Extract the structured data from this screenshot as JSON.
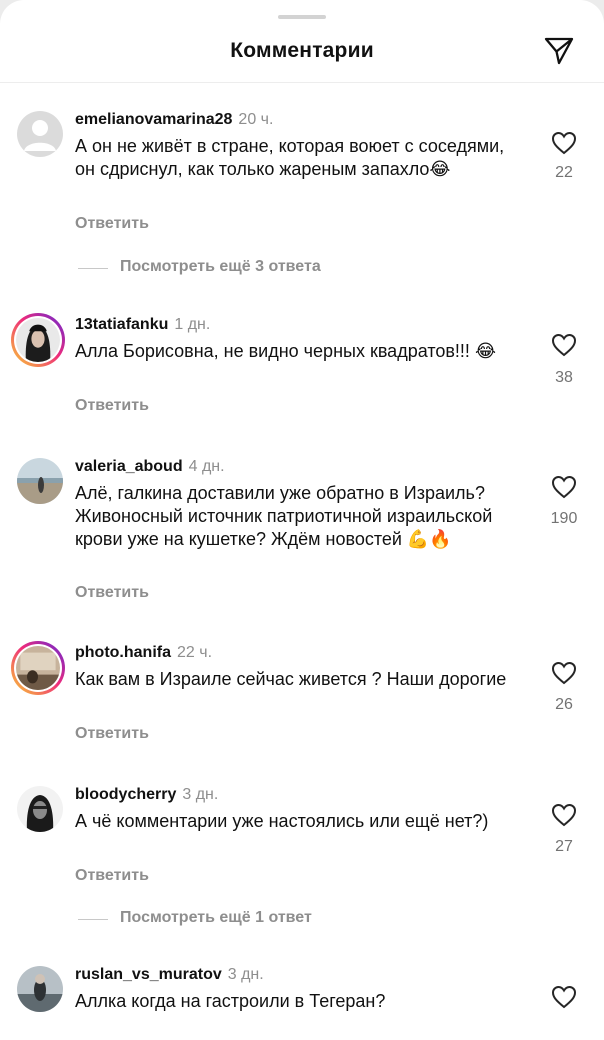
{
  "header": {
    "title": "Комментарии",
    "share_icon": "paper-plane-icon"
  },
  "comments": [
    {
      "username": "emelianovamarina28",
      "time": "20 ч.",
      "text": "А он не живёт в стране, которая воюет с соседями, он сдриснул, как только жареным запахло😂",
      "likes": "22",
      "reply_label": "Ответить",
      "more_replies": "Посмотреть ещё 3 ответа",
      "avatar": "default-avatar"
    },
    {
      "username": "13tatiafanku",
      "time": "1 дн.",
      "text": "Алла Борисовна, не видно черных квадратов!!! 😂",
      "likes": "38",
      "reply_label": "Ответить",
      "avatar": "story-avatar"
    },
    {
      "username": "valeria_aboud",
      "time": "4 дн.",
      "text": "Алё, галкина доставили уже обратно в Израиль? Живоносный источник патриотичной израильской крови уже на кушетке? Ждём новостей 💪🔥",
      "likes": "190",
      "reply_label": "Ответить",
      "avatar": "photo-avatar"
    },
    {
      "username": "photo.hanifa",
      "time": "22 ч.",
      "text": "Как вам в Израиле сейчас живется ? Наши дорогие",
      "likes": "26",
      "reply_label": "Ответить",
      "avatar": "story-avatar"
    },
    {
      "username": "bloodycherry",
      "time": "3 дн.",
      "text": "А чё комментарии уже настоялись или ещё нет?)",
      "likes": "27",
      "reply_label": "Ответить",
      "more_replies": "Посмотреть ещё 1 ответ",
      "avatar": "photo-avatar"
    },
    {
      "username": "ruslan_vs_muratov",
      "time": "3 дн.",
      "text": "Аллка когда на гастроили в Тегеран?",
      "likes": "",
      "reply_label": "",
      "avatar": "photo-avatar"
    }
  ]
}
